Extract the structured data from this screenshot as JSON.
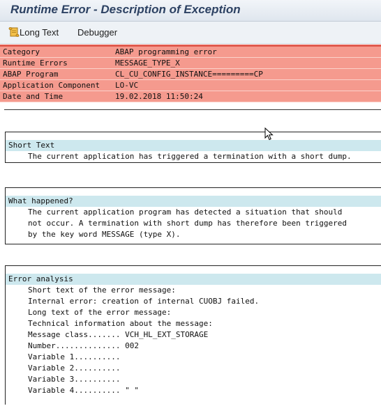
{
  "window": {
    "title": "Runtime Error - Description of Exception"
  },
  "toolbar": {
    "long_text_label": "Long Text",
    "debugger_label": "Debugger"
  },
  "info": [
    {
      "key": "Category",
      "value": "ABAP programming error"
    },
    {
      "key": "Runtime Errors",
      "value": "MESSAGE_TYPE_X"
    },
    {
      "key": "ABAP Program",
      "value": "CL_CU_CONFIG_INSTANCE=========CP"
    },
    {
      "key": "Application Component",
      "value": "LO-VC"
    },
    {
      "key": "Date and Time",
      "value": "19.02.2018 11:50:24"
    }
  ],
  "short_text": {
    "heading": "Short Text",
    "lines": [
      "The current application has triggered a termination with a short dump."
    ]
  },
  "what_happened": {
    "heading": "What happened?",
    "lines": [
      "The current application program has detected a situation that should",
      "not occur. A termination with short dump has therefore been triggered",
      "by the key word MESSAGE (type X)."
    ]
  },
  "error_analysis": {
    "heading": "Error analysis",
    "lines": [
      "Short text of the error message:",
      "Internal error: creation of internal CUOBJ failed.",
      "Long text of the error message:",
      "Technical information about the message:",
      "Message class....... VCH_HL_EXT_STORAGE",
      "Number.............. 002",
      "Variable 1..........",
      "Variable 2..........",
      "Variable 3..........",
      "Variable 4.......... \" \""
    ]
  },
  "colors": {
    "header_row_bg": "#f59a8e",
    "header_rule": "#e05a4e",
    "section_heading_bg": "#cde8ee",
    "title_text": "#2d4263"
  },
  "icons": {
    "long_text": "scroll-icon",
    "pointer": "mouse-cursor-icon"
  }
}
